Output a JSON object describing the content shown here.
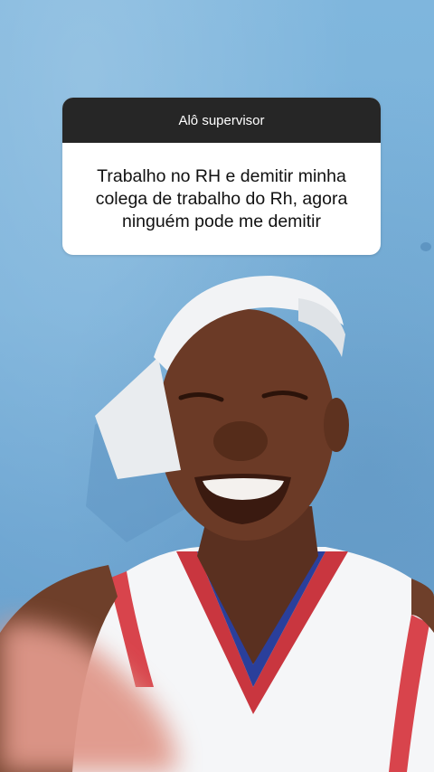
{
  "question_sticker": {
    "header": "Alô supervisor",
    "answer": "Trabalho no RH e demitir minha colega de trabalho do Rh, agora ninguém pode me demitir"
  },
  "background_photo": {
    "subject": "smiling-person-photo"
  },
  "colors": {
    "wall_blue": "#7fb6dd",
    "sticker_header_bg": "#262626",
    "sticker_body_bg": "#ffffff",
    "jersey_red": "#c9363f",
    "jersey_blue": "#2a3f9b"
  }
}
